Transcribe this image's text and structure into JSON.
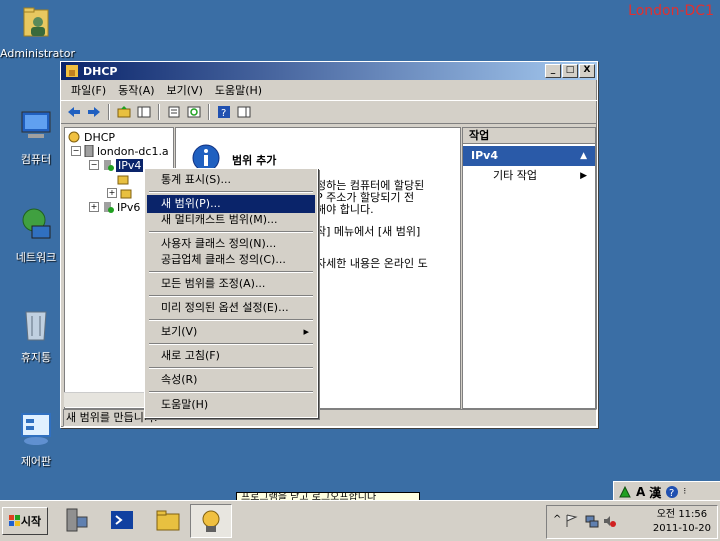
{
  "watermark": "London-DC1",
  "desktop": {
    "icons": [
      {
        "label": "Administrator",
        "icon": "user-folder-icon"
      },
      {
        "label": "컴퓨터",
        "icon": "computer-icon"
      },
      {
        "label": "네트워크",
        "icon": "network-icon"
      },
      {
        "label": "휴지통",
        "icon": "recycle-bin-icon"
      },
      {
        "label": "제어판",
        "icon": "control-panel-icon"
      }
    ]
  },
  "window": {
    "title": "DHCP",
    "controls": [
      "_",
      "□",
      "X"
    ],
    "menu": [
      "파일(F)",
      "동작(A)",
      "보기(V)",
      "도움말(H)"
    ],
    "tree": {
      "root": "DHCP",
      "server": "london-dc1.a",
      "ipv4": "IPv4",
      "ipv6": "IPv6"
    },
    "center": {
      "heading": "범위 추가",
      "lines": [
        "정하는 컴퓨터에 할당된",
        "P 주소가 할당되기 전",
        "해야 합니다.",
        "작] 메뉴에서 [새 범위]",
        "자세한 내용은 온라인 도"
      ]
    },
    "actions": {
      "header": "작업",
      "section": "IPv4",
      "item": "기타 작업"
    },
    "status": "새 범위를 만듭니다."
  },
  "context_menu": {
    "items": [
      {
        "label": "통계 표시(S)...",
        "highlight": false
      },
      {
        "label": "새 범위(P)...",
        "highlight": true
      },
      {
        "label": "새 멀티캐스트 범위(M)...",
        "highlight": false
      },
      {
        "label": "사용자 클래스 정의(N)...",
        "highlight": false
      },
      {
        "label": "공급업체 클래스 정의(C)...",
        "highlight": false
      },
      {
        "label": "모든 범위를 조정(A)...",
        "highlight": false
      },
      {
        "label": "미리 정의된 옵션 설정(E)...",
        "highlight": false
      },
      {
        "label": "보기(V)",
        "highlight": false
      },
      {
        "label": "새로 고침(F)",
        "highlight": false
      },
      {
        "label": "속성(R)",
        "highlight": false
      },
      {
        "label": "도움말(H)",
        "highlight": false
      }
    ]
  },
  "taskbar": {
    "start": "시작",
    "tooltip": "프로그램을 닫고 로그오프합니다",
    "clock_time": "오전 11:56",
    "clock_date": "2011-10-20",
    "langbar": {
      "ime_a": "A",
      "ime_han": "漢"
    }
  },
  "colors": {
    "desktop": "#3a6ea5",
    "title_active": "#0a246a",
    "highlight": "#0a246a",
    "watermark": "#e03030"
  }
}
